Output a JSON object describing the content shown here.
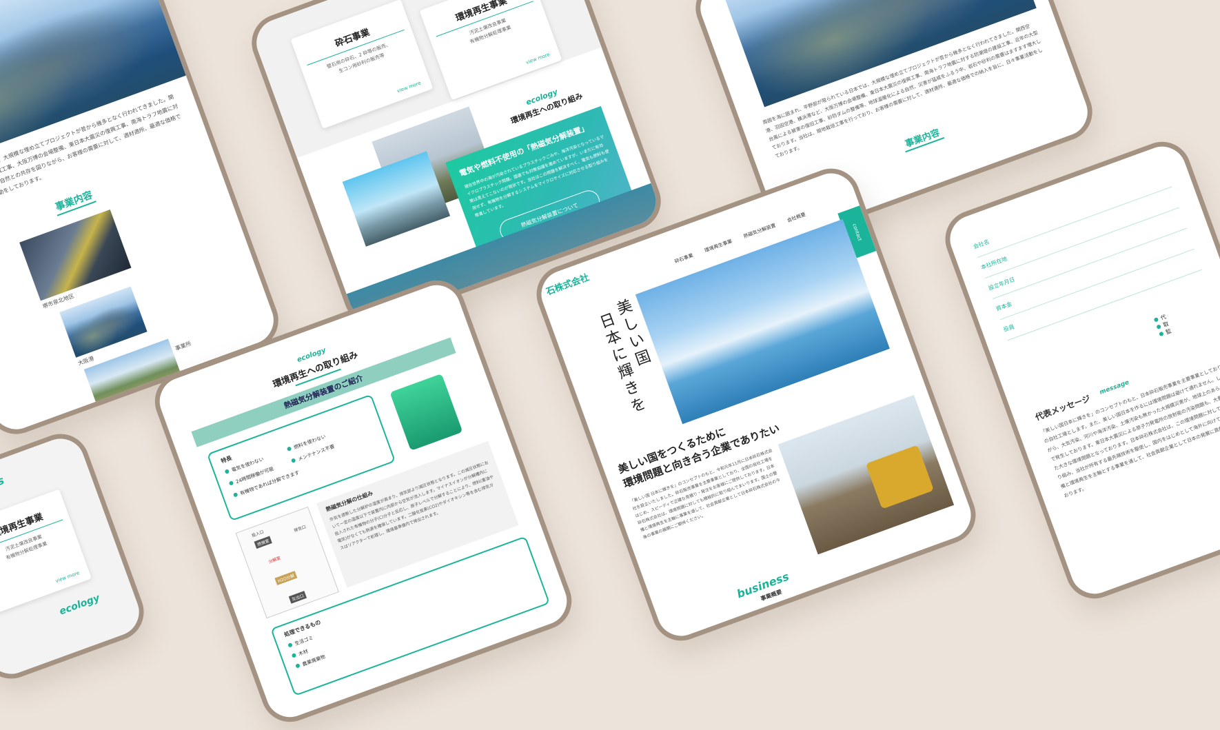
{
  "colors": {
    "background": "#ece3da",
    "bezel": "#a49383",
    "accent": "#1bb49a"
  },
  "tablet_left_top": {
    "intro": "平野部が限られている日本では、大規模な埋め立てプロジェクトが昔から幾多となく行われてきました。関西空港や、阪神工業地帯の造成工事、大阪万博の会場整備、東日本大震災の復興工事、南海トラフ地震に対する防潮堤の建設工事など、自然との共存を図りながら、お客様の需要に対して、適材適所、最適な価格での納入を旨に、日々事業活動をしております。",
    "section_title": "事業内容",
    "map_caption": "堺市泉北地区",
    "harbor_caption": "大阪港",
    "extra_caption": "事業所"
  },
  "tablet_left_bottom": {
    "tag": "business",
    "card_title": "環境再生事業",
    "card_line1": "汚泥土壌改良事業",
    "card_line2": "有機物分解処理事業",
    "more": "view more",
    "tag2": "ecology"
  },
  "tablet_center_top": {
    "card1_title": "砕石事業",
    "card1_line1": "壁石用の砕石、2 砕等の販売、",
    "card1_line2": "生コン用砂利の販売等",
    "card1_more": "view more",
    "card2_title": "環境再生事業",
    "card2_line1": "汚泥土壌改良事業",
    "card2_line2": "有機物分解処理事業",
    "card2_more": "view more",
    "eco_tag": "ecology",
    "eco_title": "環境再生への取り組み",
    "box_title": "電気や燃料不使用の「熱磁気分解装置」",
    "box_text": "現在世界中の海が汚染されているプラスチックごみや、海洋汚染となっているマイクロプラスチック問題。国連でも対策協議を進めていますが、いまだに有効策は見えてこないのが現状です。当社はこの問題を解決すべく、電気も燃料も使用せず、有機物を分解するシステムをマイクロサイズに対応させる取り組みを推進しています。",
    "box_button": "熱磁気分解装置について"
  },
  "tablet_center_bottom": {
    "tag": "ecology",
    "title": "環境再生への取り組み",
    "banner": "熱磁気分解装置のご紹介",
    "features_title": "特長",
    "features": [
      "電気を使わない",
      "燃料を使わない",
      "メンテナンス不要",
      "24時間稼働が可能",
      "有機物であれば分解できます"
    ],
    "diagram_labels": [
      "投入口",
      "燃焼室",
      "分解室",
      "排気口",
      "H2O分解",
      "灰出口"
    ],
    "mechanism_title": "熱磁気分解の仕組み",
    "mechanism_text": "外気を遮断した分解炉の温度が高まり、排気部より減圧状態となります。この減圧状態において一定の温度以下で装置内に内部から空気が流入します。マイナスイオンが分解槽内に投入された有機物の分子(C)分子と反応し、原子レベルで分解することにより、燃料(重油や電気)がなくても熱源を確保しています。二酸化炭素(CO2)やダイオキシン等を含む排気ガスはリアクターで処理し、環境基準値内で排出されます。",
    "process_title": "処理できるもの",
    "process_items": [
      "生活ゴミ",
      "木材",
      "農業廃棄物"
    ]
  },
  "tablet_right_top": {
    "intro": "周囲を海に囲まれ、平野部が限られている日本では、大規模な埋め立てプロジェクトが昔から幾多となく行われてきました。関西空港、羽田空港、横浜港など、大阪万博の会場整備、東日本大震災の復興工事、南海トラフ地震に対する防潮堤の建設工事、近年の大型台風による被害の復旧工事、砂防ダムの整備等、地球温暖化による自然、災害が猛威をふるう中、岩石や砂利の需要はますます増大しております。当社は、現地栽培工事を行っており、お客様の需要に対して、適材適所、最適な価格での納入を旨に、日々事業活動をしております。",
    "section_title": "事業内容"
  },
  "tablet_right_main": {
    "company": "石株式会社",
    "nav": [
      "砕石事業",
      "環境再生事業",
      "熱磁気分解装置",
      "会社概要"
    ],
    "vertical1": "美しい国",
    "vertical2": "日本に輝きを",
    "contact": "contact",
    "headline1": "美しい国をつくるために",
    "headline2": "環境問題と向き合う企業でありたい",
    "body": "「美しい国 日本に輝きを」のコンセプトのもと、令和元年11月に日本砕石株式会社を設立いたしました。砕石販売事業を主要事業としており、全国の自社工場をはじめ、スピーディで正確な見積り・発注をお客様にご提供しております。日本砕石株式会社は、環境問題に対しても積極的に取り組んでまいります。国土の整備と環境再生を主軸に事業を通して、社会貢献企業として日本砕石株式会社の今後の事業の展開にご期待ください。",
    "business_tag": "business",
    "business_sub": "事業概要"
  },
  "tablet_far_right": {
    "rows": [
      "会社名",
      "本社所在地",
      "設立年月日",
      "資本金",
      "役員"
    ],
    "bullets": [
      "代",
      "取",
      "監"
    ],
    "message_title": "代表メッセージ",
    "message_tag": "message",
    "message_text": "「美しい国日本に輝きを」のコンセプトのもと、日本砕石販売事業を主要事業としており、全国の自社工場とします。また、美しい国日本を作るには環境問題は避けて通れません。しかしながら、大気汚染、河川や海洋汚染、土壌汚染も無かった大規模災害が、地球上のあらゆる場所で発生しております。東日本大震災による原子力発電所の放射能の汚染問題も、大量に廃棄された大きな環境問題となっております。日本砕石株式会社は、この環境問題に対しても積極的に取り組み、当社が所有する最先端技術を駆使し、国内をはじめとして海外に向けても、国土の整備と環境再生を主軸とする事業を通して、社会貢献企業として日本の発展に貢献したいと考えております。"
  }
}
